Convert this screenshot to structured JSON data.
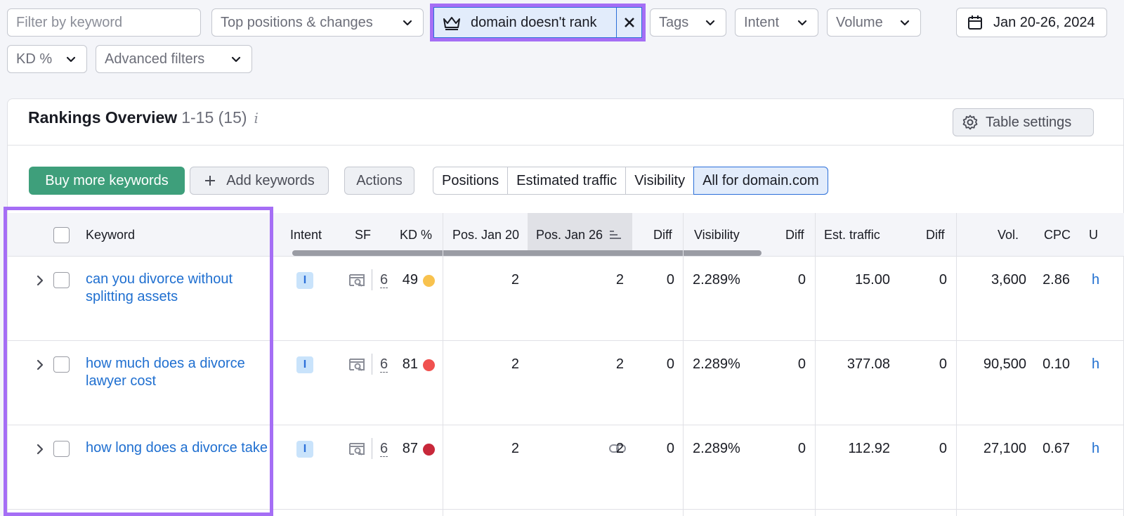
{
  "filters": {
    "search_placeholder": "Filter by keyword",
    "top_positions": "Top positions & changes",
    "active_chip": "domain doesn't rank",
    "tags": "Tags",
    "intent": "Intent",
    "volume": "Volume",
    "date": "Jan 20-26, 2024",
    "kd": "KD %",
    "advanced": "Advanced filters"
  },
  "card": {
    "title": "Rankings Overview",
    "range": "1-15 (15)",
    "info": "i",
    "table_settings": "Table settings"
  },
  "toolbar": {
    "buy": "Buy more keywords",
    "add": "Add keywords",
    "actions": "Actions",
    "segments": [
      "Positions",
      "Estimated traffic",
      "Visibility",
      "All for domain.com"
    ]
  },
  "columns": {
    "keyword": "Keyword",
    "intent": "Intent",
    "sf": "SF",
    "kd": "KD %",
    "pos1": "Pos. Jan 20",
    "pos2": "Pos. Jan 26",
    "diff": "Diff",
    "visibility": "Visibility",
    "diff2": "Diff",
    "traffic": "Est. traffic",
    "diff3": "Diff",
    "vol": "Vol.",
    "cpc": "CPC",
    "u": "U"
  },
  "rows": [
    {
      "keyword": "can you divorce without splitting assets",
      "intent": "I",
      "sf": "6",
      "kd": "49",
      "kd_color": "#f8c24e",
      "pos1": "2",
      "pos2": "2",
      "diff": "0",
      "visibility": "2.289%",
      "vis_diff": "0",
      "traffic": "15.00",
      "traffic_diff": "0",
      "vol": "3,600",
      "cpc": "2.86",
      "u": "h"
    },
    {
      "keyword": "how much does a divorce lawyer cost",
      "intent": "I",
      "sf": "6",
      "kd": "81",
      "kd_color": "#f0514f",
      "pos1": "2",
      "pos2": "2",
      "diff": "0",
      "visibility": "2.289%",
      "vis_diff": "0",
      "traffic": "377.08",
      "traffic_diff": "0",
      "vol": "90,500",
      "cpc": "0.10",
      "u": "h"
    },
    {
      "keyword": "how long does a divorce take",
      "intent": "I",
      "sf": "6",
      "kd": "87",
      "kd_color": "#c8283a",
      "pos1": "2",
      "pos2": "2",
      "diff": "0",
      "visibility": "2.289%",
      "vis_diff": "0",
      "traffic": "112.92",
      "traffic_diff": "0",
      "vol": "27,100",
      "cpc": "0.67",
      "u": "h"
    }
  ],
  "colors": {
    "accent": "#a56ef5",
    "link": "#1f6fd0",
    "green": "#3e9f7b"
  }
}
